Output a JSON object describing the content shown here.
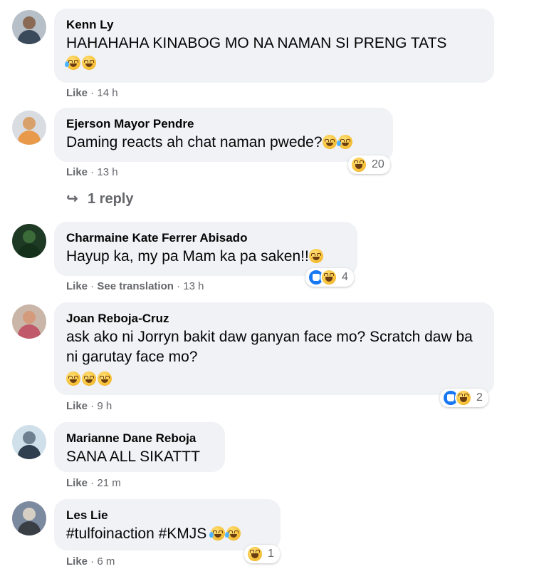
{
  "comments": [
    {
      "author": "Kenn Ly",
      "text": "HAHAHAHA KINABOG MO NA NAMAN SI PRENG TATS",
      "emojis": [
        "crying-laughing",
        "grinning"
      ],
      "like_label": "Like",
      "time": "14 h",
      "avatar_colors": {
        "bg": "#b7c0c8",
        "head": "#8a6a55",
        "body": "#3b4a5a"
      }
    },
    {
      "author": "Ejerson Mayor Pendre",
      "text": "Daming reacts ah chat naman pwede?",
      "emojis": [
        "grimacing",
        "rolling-laughing"
      ],
      "like_label": "Like",
      "time": "13 h",
      "reactions": {
        "icons": [
          "haha"
        ],
        "count": "20"
      },
      "avatar_colors": {
        "bg": "#d9dde2",
        "head": "#d8a06a",
        "body": "#e89a4a"
      }
    },
    {
      "author": "Charmaine Kate Ferrer Abisado",
      "text": "Hayup ka, my pa Mam ka pa saken!!",
      "emojis": [
        "grimacing"
      ],
      "like_label": "Like",
      "translate_label": "See translation",
      "time": "13 h",
      "reactions": {
        "icons": [
          "like",
          "haha"
        ],
        "count": "4"
      },
      "avatar_colors": {
        "bg": "#1f3a24",
        "head": "#3c6b3a",
        "body": "#14301a"
      }
    },
    {
      "author": "Joan Reboja-Cruz",
      "text": "ask ako ni Jorryn bakit daw ganyan face mo? Scratch daw ba ni garutay face mo?",
      "emojis": [
        "grinning",
        "grinning",
        "grinning"
      ],
      "like_label": "Like",
      "time": "9 h",
      "reactions": {
        "icons": [
          "like",
          "haha"
        ],
        "count": "2"
      },
      "avatar_colors": {
        "bg": "#c9b6a8",
        "head": "#d49a7c",
        "body": "#c05a6a"
      }
    },
    {
      "author": "Marianne Dane Reboja",
      "text": "SANA ALL SIKATTT",
      "emojis": [],
      "like_label": "Like",
      "time": "21 m",
      "avatar_colors": {
        "bg": "#cfe0ea",
        "head": "#6f8090",
        "body": "#2f3f4f"
      }
    },
    {
      "author": "Les Lie",
      "text": "#tulfoinaction #KMJS",
      "emojis": [
        "crying-laughing",
        "crying-laughing"
      ],
      "like_label": "Like",
      "time": "6 m",
      "reactions": {
        "icons": [
          "haha"
        ],
        "count": "1"
      },
      "avatar_colors": {
        "bg": "#7c8aa0",
        "head": "#d6d0c4",
        "body": "#3a3f46"
      }
    }
  ],
  "replies": {
    "label": "1 reply",
    "icon": "reply-arrow-icon"
  },
  "separator": " · "
}
